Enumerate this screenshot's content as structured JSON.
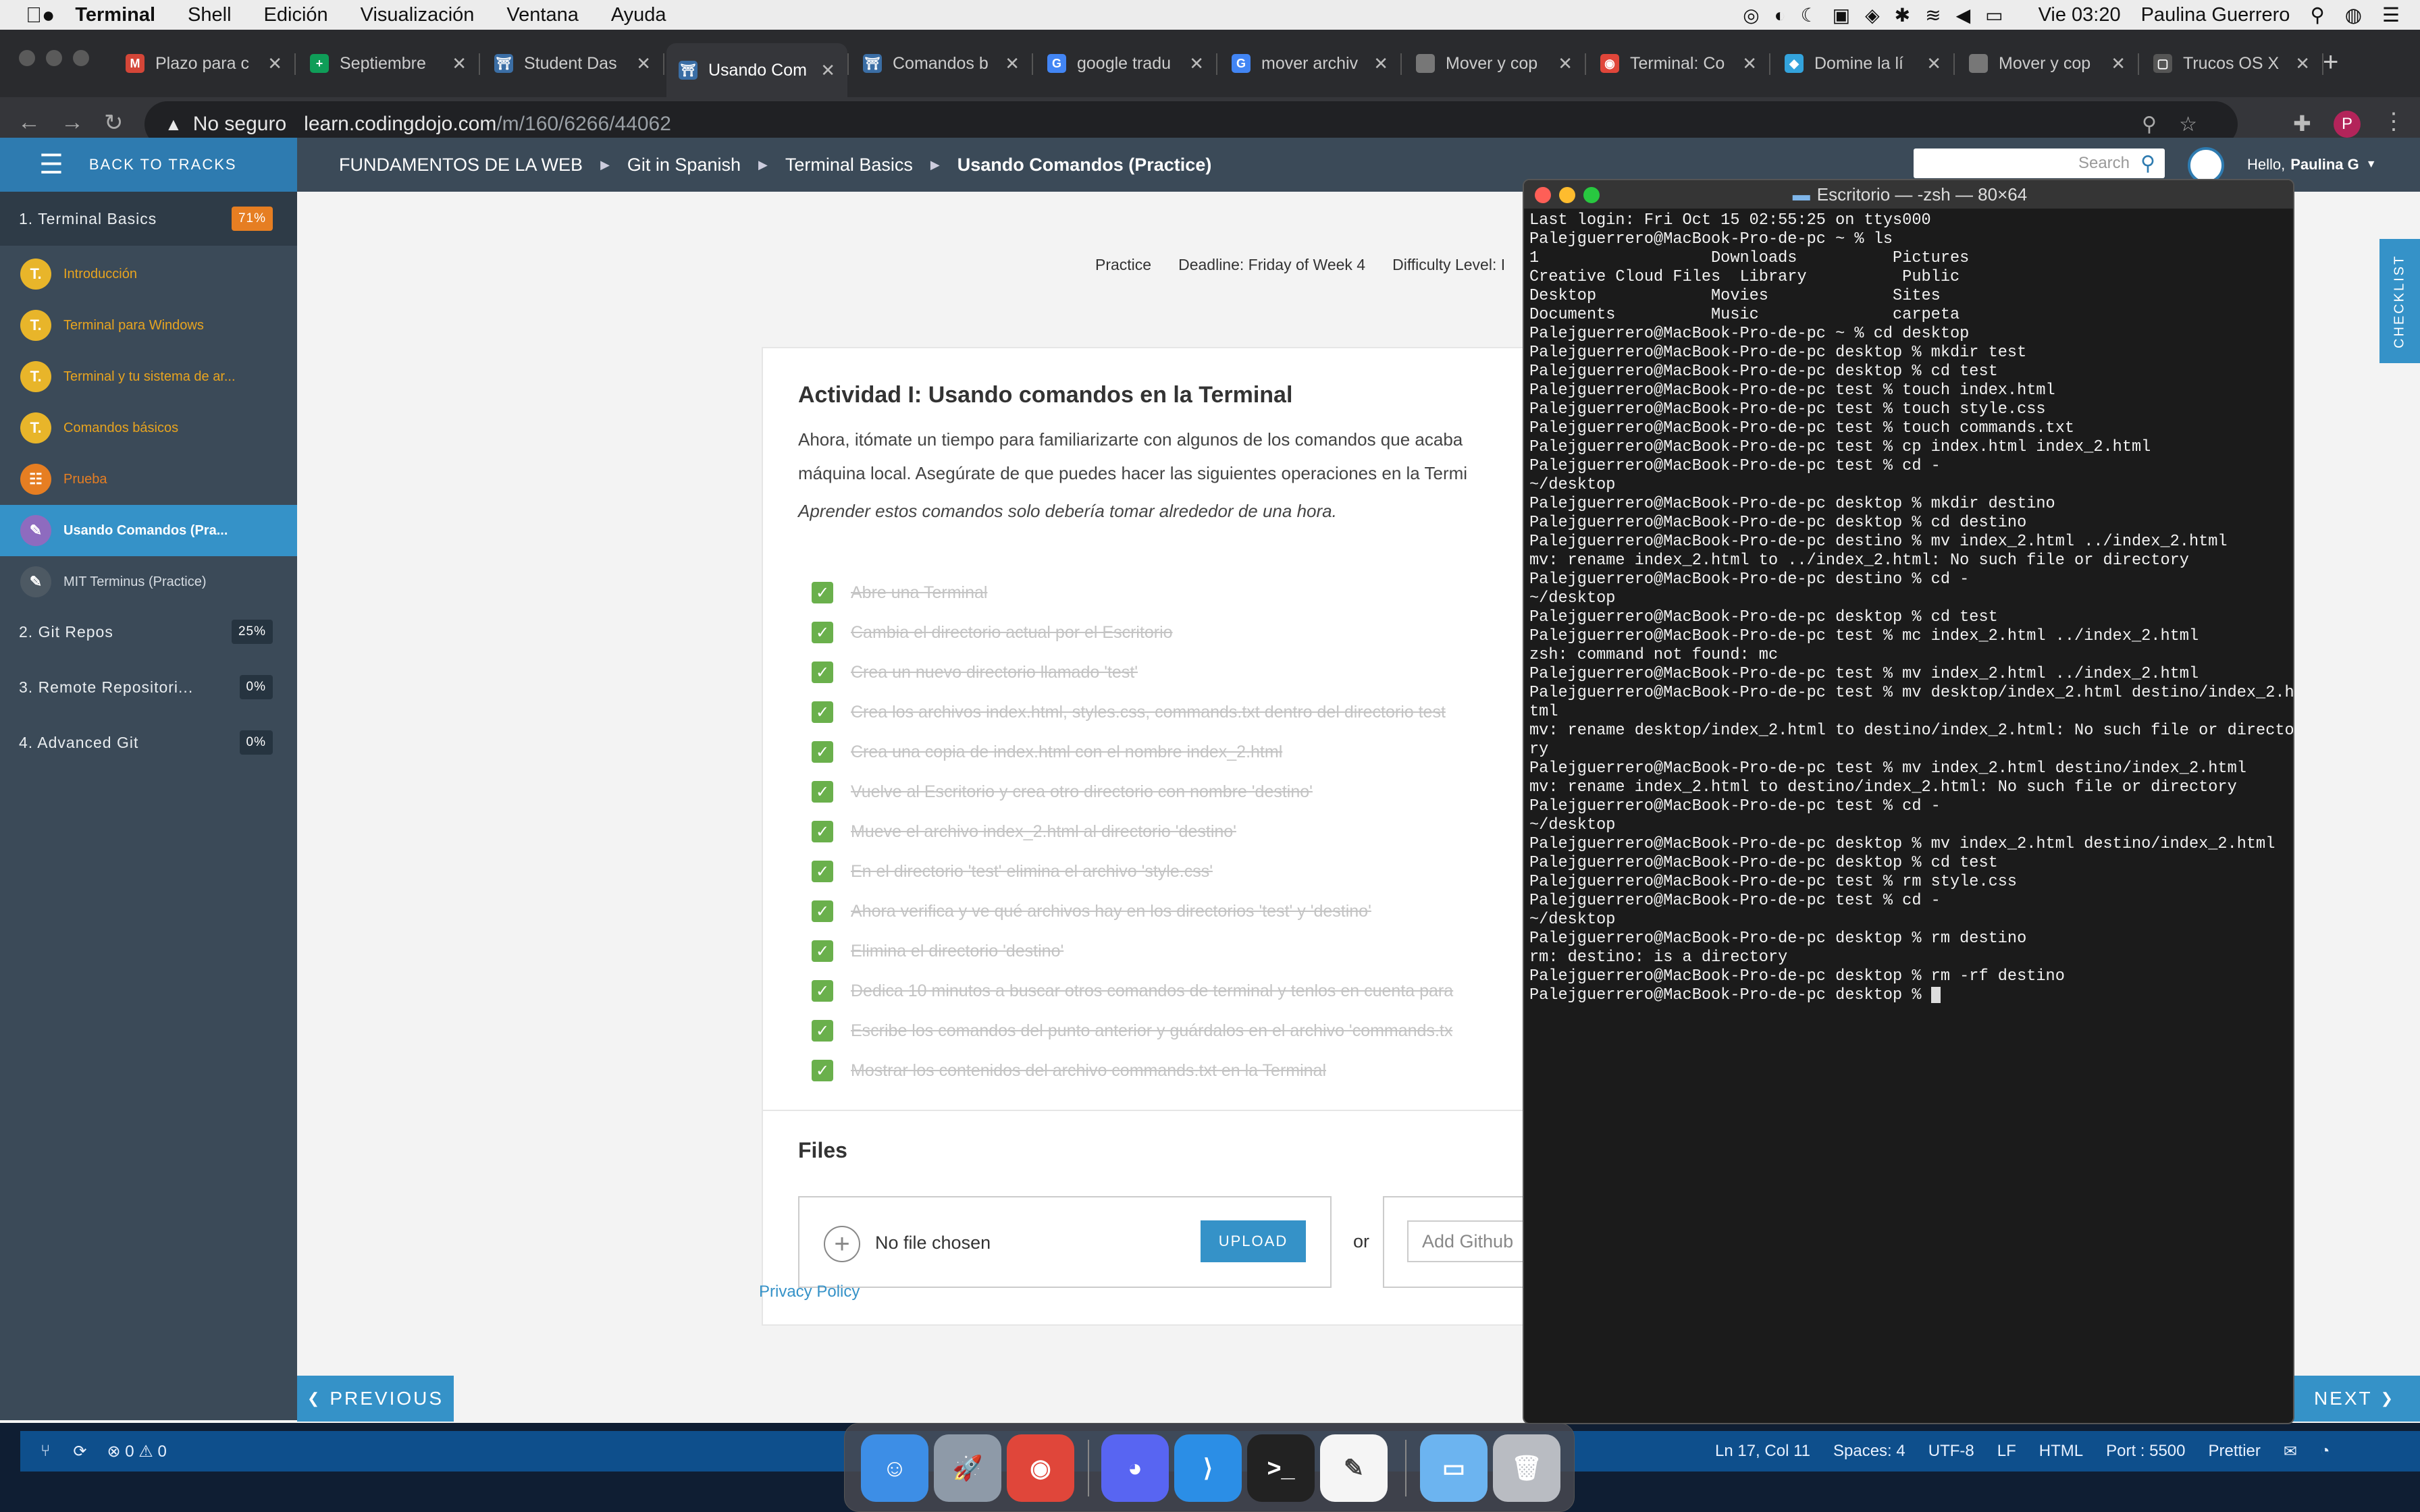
{
  "menubar": {
    "app": "Terminal",
    "items": [
      "Shell",
      "Edición",
      "Visualización",
      "Ventana",
      "Ayuda"
    ],
    "clock": "Vie 03:20",
    "user": "Paulina Guerrero"
  },
  "browser": {
    "tabs": [
      {
        "label": "Plazo para c",
        "fav": "M",
        "color": "#d44638"
      },
      {
        "label": "Septiembre",
        "fav": "+",
        "color": "#0f9d58"
      },
      {
        "label": "Student Das",
        "fav": "⛩",
        "color": "#3b6ea5"
      },
      {
        "label": "Usando Com",
        "fav": "⛩",
        "color": "#3b6ea5"
      },
      {
        "label": "Comandos b",
        "fav": "⛩",
        "color": "#3b6ea5"
      },
      {
        "label": "google tradu",
        "fav": "G",
        "color": "#4285f4"
      },
      {
        "label": "mover archiv",
        "fav": "G",
        "color": "#4285f4"
      },
      {
        "label": "Mover y cop",
        "fav": "",
        "color": "#777"
      },
      {
        "label": "Terminal: Co",
        "fav": "◉",
        "color": "#e0463a"
      },
      {
        "label": "Domine la lí",
        "fav": "◆",
        "color": "#33a3dc"
      },
      {
        "label": "Mover y cop",
        "fav": "",
        "color": "#777"
      },
      {
        "label": "Trucos OS X",
        "fav": "▢",
        "color": "#555"
      }
    ],
    "security": "No seguro",
    "url_host": "learn.codingdojo.com",
    "url_path": "/m/160/6266/44062",
    "profile": "P"
  },
  "sidebar": {
    "back": "BACK TO TRACKS",
    "sections": [
      {
        "label": "1. Terminal Basics",
        "pct": "71%"
      },
      {
        "label": "2. Git Repos",
        "pct": "25%"
      },
      {
        "label": "3. Remote Repositori...",
        "pct": "0%"
      },
      {
        "label": "4. Advanced Git",
        "pct": "0%"
      }
    ],
    "items": [
      {
        "label": "Introducción"
      },
      {
        "label": "Terminal para Windows"
      },
      {
        "label": "Terminal y tu sistema de ar..."
      },
      {
        "label": "Comandos básicos"
      },
      {
        "label": "Prueba"
      },
      {
        "label": "Usando Comandos (Pra..."
      },
      {
        "label": "MIT Terminus (Practice)"
      }
    ]
  },
  "header": {
    "crumbs": [
      "FUNDAMENTOS DE LA WEB",
      "Git in Spanish",
      "Terminal Basics",
      "Usando Comandos (Practice)"
    ],
    "search_placeholder": "Search",
    "hello": "Hello,",
    "user": "Paulina G"
  },
  "meta": {
    "type": "Practice",
    "deadline": "Deadline: Friday of Week 4",
    "difficulty": "Difficulty Level: I"
  },
  "activity": {
    "title": "Actividad I: Usando comandos en la Terminal",
    "intro1": "Ahora, itómate un tiempo para familiarizarte con algunos de los comandos que acaba",
    "intro2": "máquina local. Asegúrate de que puedes hacer las siguientes operaciones en la Termi",
    "note": "Aprender estos comandos solo debería tomar alrededor de una hora.",
    "tasks": [
      "Abre una Terminal",
      "Cambia el directorio actual por el Escritorio",
      "Crea un nuevo directorio llamado 'test'",
      "Crea los archivos index.html, styles.css, commands.txt dentro del directorio test",
      "Crea una copia de index.html con el nombre index_2.html",
      "Vuelve al Escritorio y crea otro directorio con nombre 'destino'",
      "Mueve el archivo index_2.html al directorio 'destino'",
      "En el directorio 'test' elimina el archivo 'style.css'",
      "Ahora verifica y ve qué archivos hay en los directorios 'test' y 'destino'",
      "Elimina el directorio 'destino'",
      "Dedica 10 minutos a buscar otros comandos de terminal y tenlos en cuenta para",
      "Escribe los comandos del punto anterior y guárdalos en el archivo 'commands.tx",
      "Mostrar los contenidos del archivo commands.txt en la Terminal"
    ],
    "files_title": "Files",
    "no_file": "No file chosen",
    "upload": "UPLOAD",
    "or": "or",
    "github_placeholder": "Add Github"
  },
  "footer": {
    "privacy": "Privacy Policy",
    "previous": "PREVIOUS",
    "next": "NEXT",
    "checklist": "CHECKLIST"
  },
  "terminal": {
    "title": "Escritorio — -zsh — 80×64",
    "lines": [
      "Last login: Fri Oct 15 02:55:25 on ttys000",
      "Palejguerrero@MacBook-Pro-de-pc ~ % ls",
      "1                  Downloads          Pictures",
      "Creative Cloud Files  Library          Public",
      "Desktop            Movies             Sites",
      "Documents          Music              carpeta",
      "Palejguerrero@MacBook-Pro-de-pc ~ % cd desktop",
      "Palejguerrero@MacBook-Pro-de-pc desktop % mkdir test",
      "Palejguerrero@MacBook-Pro-de-pc desktop % cd test",
      "Palejguerrero@MacBook-Pro-de-pc test % touch index.html",
      "Palejguerrero@MacBook-Pro-de-pc test % touch style.css",
      "Palejguerrero@MacBook-Pro-de-pc test % touch commands.txt",
      "Palejguerrero@MacBook-Pro-de-pc test % cp index.html index_2.html",
      "Palejguerrero@MacBook-Pro-de-pc test % cd -",
      "~/desktop",
      "Palejguerrero@MacBook-Pro-de-pc desktop % mkdir destino",
      "Palejguerrero@MacBook-Pro-de-pc desktop % cd destino",
      "Palejguerrero@MacBook-Pro-de-pc destino % mv index_2.html ../index_2.html",
      "mv: rename index_2.html to ../index_2.html: No such file or directory",
      "Palejguerrero@MacBook-Pro-de-pc destino % cd -",
      "~/desktop",
      "Palejguerrero@MacBook-Pro-de-pc desktop % cd test",
      "Palejguerrero@MacBook-Pro-de-pc test % mc index_2.html ../index_2.html",
      "zsh: command not found: mc",
      "Palejguerrero@MacBook-Pro-de-pc test % mv index_2.html ../index_2.html",
      "Palejguerrero@MacBook-Pro-de-pc test % mv desktop/index_2.html destino/index_2.h",
      "tml",
      "mv: rename desktop/index_2.html to destino/index_2.html: No such file or directo",
      "ry",
      "Palejguerrero@MacBook-Pro-de-pc test % mv index_2.html destino/index_2.html",
      "mv: rename index_2.html to destino/index_2.html: No such file or directory",
      "Palejguerrero@MacBook-Pro-de-pc test % cd -",
      "~/desktop",
      "Palejguerrero@MacBook-Pro-de-pc desktop % mv index_2.html destino/index_2.html",
      "Palejguerrero@MacBook-Pro-de-pc desktop % cd test",
      "Palejguerrero@MacBook-Pro-de-pc test % rm style.css",
      "Palejguerrero@MacBook-Pro-de-pc test % cd -",
      "~/desktop",
      "Palejguerrero@MacBook-Pro-de-pc desktop % rm destino",
      "rm: destino: is a directory",
      "Palejguerrero@MacBook-Pro-de-pc desktop % rm -rf destino",
      "Palejguerrero@MacBook-Pro-de-pc desktop % "
    ]
  },
  "vscode_status": {
    "sync": "⟳",
    "problems": "⊗ 0 ⚠ 0",
    "position": "Ln 17, Col 11",
    "spaces": "Spaces: 4",
    "encoding": "UTF-8",
    "eol": "LF",
    "lang": "HTML",
    "port": "Port : 5500",
    "prettier": "Prettier"
  },
  "dock": [
    {
      "name": "finder",
      "glyph": "☺",
      "color": "#3d8ee6"
    },
    {
      "name": "launchpad",
      "glyph": "🚀",
      "color": "#8e9aa8"
    },
    {
      "name": "chrome",
      "glyph": "◉",
      "color": "#e0463a"
    },
    {
      "name": "discord",
      "glyph": "◕",
      "color": "#5865f2"
    },
    {
      "name": "vscode",
      "glyph": "⟩",
      "color": "#2b8ee6"
    },
    {
      "name": "terminal",
      "glyph": ">_",
      "color": "#222"
    },
    {
      "name": "textedit",
      "glyph": "✎",
      "color": "#f5f5f5"
    },
    {
      "name": "folder",
      "glyph": "▭",
      "color": "#6cb4f0"
    },
    {
      "name": "trash",
      "glyph": "🗑",
      "color": "#b9bcc2"
    }
  ]
}
